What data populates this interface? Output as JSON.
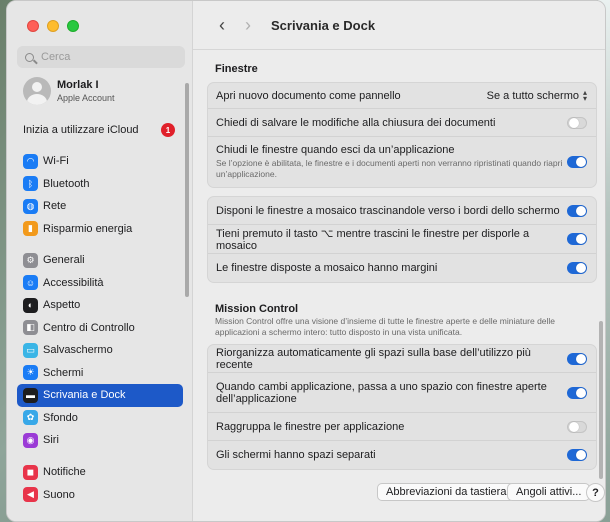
{
  "search": {
    "placeholder": "Cerca"
  },
  "account": {
    "name": "Morlak I",
    "subtitle": "Apple Account"
  },
  "icloud": {
    "label": "Inizia a utilizzare iCloud",
    "badge": "1"
  },
  "sidebar": {
    "group1": [
      {
        "label": "Wi-Fi",
        "icon": "wifi-icon",
        "color": "#1a7cf5",
        "glyph": "◠"
      },
      {
        "label": "Bluetooth",
        "icon": "bluetooth-icon",
        "color": "#1a7cf5",
        "glyph": "ᛒ"
      },
      {
        "label": "Rete",
        "icon": "network-icon",
        "color": "#1a7cf5",
        "glyph": "◍"
      },
      {
        "label": "Risparmio energia",
        "icon": "battery-icon",
        "color": "#f29a1c",
        "glyph": "▮"
      }
    ],
    "group2": [
      {
        "label": "Generali",
        "icon": "gear-icon",
        "color": "#8e8e93",
        "glyph": "⚙"
      },
      {
        "label": "Accessibilità",
        "icon": "accessibility-icon",
        "color": "#1a7cf5",
        "glyph": "☺"
      },
      {
        "label": "Aspetto",
        "icon": "appearance-icon",
        "color": "#1d1d1f",
        "glyph": "◐"
      },
      {
        "label": "Centro di Controllo",
        "icon": "control-center-icon",
        "color": "#8e8e93",
        "glyph": "◧"
      },
      {
        "label": "Salvaschermo",
        "icon": "screensaver-icon",
        "color": "#3ab5e6",
        "glyph": "▭"
      },
      {
        "label": "Schermi",
        "icon": "display-icon",
        "color": "#1a7cf5",
        "glyph": "☀"
      },
      {
        "label": "Scrivania e Dock",
        "icon": "dock-icon",
        "color": "#1d1d1f",
        "glyph": "▬",
        "selected": true
      },
      {
        "label": "Sfondo",
        "icon": "wallpaper-icon",
        "color": "#38a8e8",
        "glyph": "✿"
      },
      {
        "label": "Siri",
        "icon": "siri-icon",
        "color": "#9b3bd6",
        "glyph": "◉"
      }
    ],
    "group3": [
      {
        "label": "Notifiche",
        "icon": "notifications-icon",
        "color": "#e8344a",
        "glyph": "◼"
      },
      {
        "label": "Suono",
        "icon": "sound-icon",
        "color": "#e8344a",
        "glyph": "◀"
      }
    ]
  },
  "header": {
    "title": "Scrivania e Dock"
  },
  "windows_section": {
    "title": "Finestre",
    "rows1": [
      {
        "label": "Apri nuovo documento come pannello",
        "control": "select",
        "value": "Se a tutto schermo"
      },
      {
        "label": "Chiedi di salvare le modifiche alla chiusura dei documenti",
        "control": "toggle",
        "on": false
      },
      {
        "label": "Chiudi le finestre quando esci da un’applicazione",
        "desc": "Se l’opzione è abilitata, le finestre e i documenti aperti non verranno ripristinati quando riapri un’applicazione.",
        "control": "toggle",
        "on": true
      }
    ],
    "rows2": [
      {
        "label": "Disponi le finestre a mosaico trascinandole verso i bordi dello schermo",
        "on": true
      },
      {
        "label": "Tieni premuto il tasto ⌥ mentre trascini le finestre per disporle a mosaico",
        "on": true
      },
      {
        "label": "Le finestre disposte a mosaico hanno margini",
        "on": true
      }
    ]
  },
  "mission_control": {
    "title": "Mission Control",
    "description": "Mission Control offre una visione d’insieme di tutte le finestre aperte e delle miniature delle applicazioni a schermo intero: tutto disposto in una vista unificata.",
    "rows": [
      {
        "label": "Riorganizza automaticamente gli spazi sulla base dell’utilizzo più recente",
        "on": true
      },
      {
        "label": "Quando cambi applicazione, passa a uno spazio con finestre aperte dell’applicazione",
        "on": true
      },
      {
        "label": "Raggruppa le finestre per applicazione",
        "on": false
      },
      {
        "label": "Gli schermi hanno spazi separati",
        "on": true
      }
    ]
  },
  "footer": {
    "shortcuts_label": "Abbreviazioni da tastiera",
    "hot_corners_label": "Angoli attivi...",
    "help_label": "?"
  }
}
